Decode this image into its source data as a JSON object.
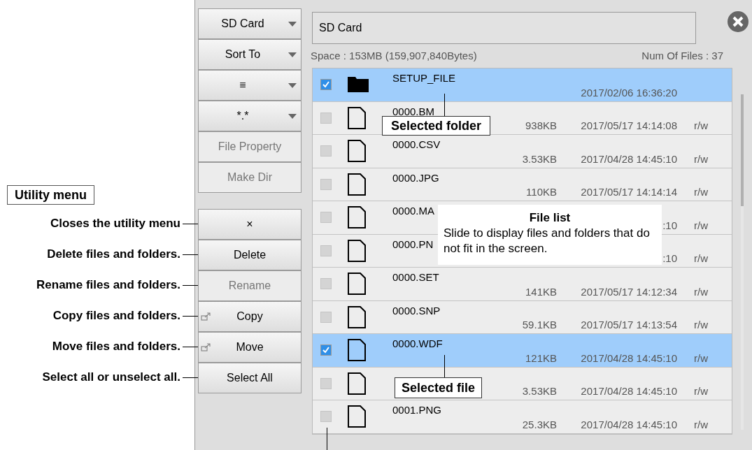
{
  "side_buttons": [
    {
      "label": "SD Card",
      "kind": "dropdown",
      "disabled": false
    },
    {
      "label": "Sort To",
      "kind": "dropdown",
      "disabled": false
    },
    {
      "label": "≡",
      "kind": "dropdown",
      "disabled": false
    },
    {
      "label": "*.*",
      "kind": "dropdown",
      "disabled": false
    },
    {
      "label": "File Property",
      "kind": "plain",
      "disabled": true
    },
    {
      "label": "Make Dir",
      "kind": "plain",
      "disabled": true
    }
  ],
  "utility_menu": {
    "title": "Utility menu",
    "buttons": [
      {
        "label": "×",
        "kind": "plain",
        "disabled": false,
        "note": "Closes the utility menu"
      },
      {
        "label": "Delete",
        "kind": "plain",
        "disabled": false,
        "note": "Delete files and folders."
      },
      {
        "label": "Rename",
        "kind": "plain",
        "disabled": true,
        "note": "Rename files and folders."
      },
      {
        "label": "Copy",
        "kind": "transfer",
        "disabled": false,
        "note": "Copy files and folders."
      },
      {
        "label": "Move",
        "kind": "transfer",
        "disabled": false,
        "note": "Move files and folders."
      },
      {
        "label": "Select All",
        "kind": "plain",
        "disabled": false,
        "note": "Select all or unselect all."
      }
    ]
  },
  "path": "SD Card",
  "space": "Space : 153MB (159,907,840Bytes)",
  "num_files": "Num Of Files : 37",
  "files": [
    {
      "kind": "folder",
      "name": "SETUP_FILE",
      "date": "2017/02/06 16:36:20",
      "checked": true,
      "selected": true
    },
    {
      "kind": "file",
      "name": "0000.BM",
      "size": "938KB",
      "date": "2017/05/17 14:14:08",
      "access": "r/w",
      "checked": false,
      "selected": false
    },
    {
      "kind": "file",
      "name": "0000.CSV",
      "size": "3.53KB",
      "date": "2017/04/28 14:45:10",
      "access": "r/w",
      "checked": false,
      "selected": false
    },
    {
      "kind": "file",
      "name": "0000.JPG",
      "size": "110KB",
      "date": "2017/05/17 14:14:14",
      "access": "r/w",
      "checked": false,
      "selected": false
    },
    {
      "kind": "file",
      "name": "0000.MA",
      "date": ":10",
      "access": "r/w",
      "checked": false,
      "selected": false
    },
    {
      "kind": "file",
      "name": "0000.PN",
      "date": ":10",
      "access": "r/w",
      "checked": false,
      "selected": false
    },
    {
      "kind": "file",
      "name": "0000.SET",
      "size": "141KB",
      "date": "2017/05/17 14:12:34",
      "access": "r/w",
      "checked": false,
      "selected": false
    },
    {
      "kind": "file",
      "name": "0000.SNP",
      "size": "59.1KB",
      "date": "2017/05/17 14:13:54",
      "access": "r/w",
      "checked": false,
      "selected": false
    },
    {
      "kind": "file",
      "name": "0000.WDF",
      "size": "121KB",
      "date": "2017/04/28 14:45:10",
      "access": "r/w",
      "checked": true,
      "selected": true
    },
    {
      "kind": "file",
      "size": "3.53KB",
      "date": "2017/04/28 14:45:10",
      "access": "r/w",
      "checked": false,
      "selected": false
    },
    {
      "kind": "file",
      "name": "0001.PNG",
      "size": "25.3KB",
      "date": "2017/04/28 14:45:10",
      "access": "r/w",
      "checked": false,
      "selected": false
    }
  ],
  "callouts": [
    {
      "kind": "selected_folder",
      "label": "Selected folder"
    },
    {
      "kind": "file_list",
      "title": "File list",
      "text": "Slide to display files and folders that do not fit in the screen."
    },
    {
      "kind": "selected_file",
      "label": "Selected file"
    },
    {
      "kind": "pointer"
    }
  ]
}
